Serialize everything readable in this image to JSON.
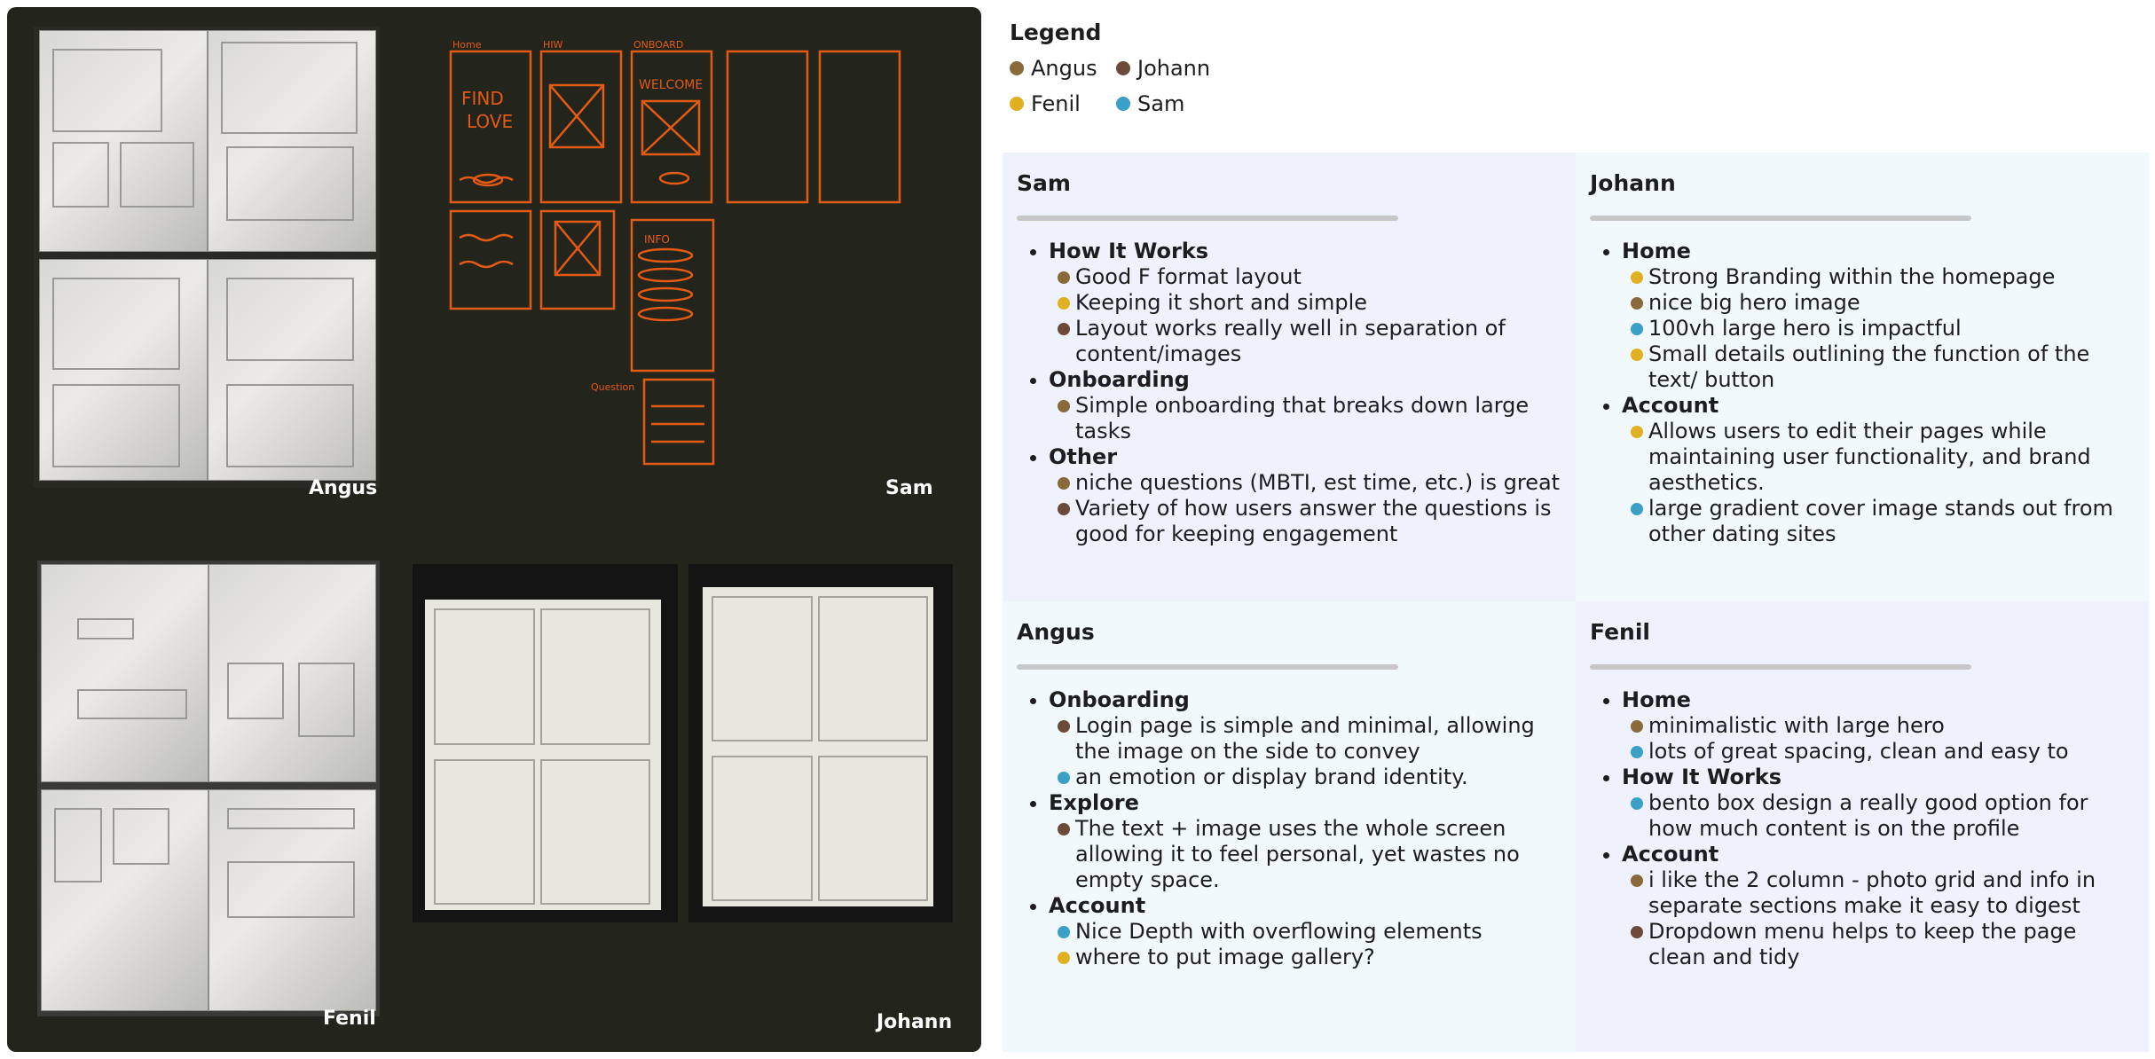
{
  "legend": {
    "title": "Legend",
    "people": [
      {
        "name": "Angus",
        "color": "#8a6a3b"
      },
      {
        "name": "Johann",
        "color": "#6b4a3a"
      },
      {
        "name": "Fenil",
        "color": "#e0b020"
      },
      {
        "name": "Sam",
        "color": "#3aa0c8"
      }
    ]
  },
  "photos": {
    "angus_caption": "Angus",
    "sam_caption": "Sam",
    "fenil_caption": "Fenil",
    "johann_caption": "Johann",
    "sam_sketch": {
      "color": "#e35a14",
      "labels": [
        "Home",
        "HIW",
        "ONBOARD",
        "FIND LOVE",
        "WELCOME",
        "INFO",
        "Question"
      ]
    }
  },
  "cards": [
    {
      "person": "Sam",
      "sections": [
        {
          "title": "How It Works",
          "items": [
            {
              "by": "Angus",
              "text": "Good F format layout"
            },
            {
              "by": "Fenil",
              "text": "Keeping it short and simple"
            },
            {
              "by": "Johann",
              "text": "Layout works really well in separation of content/images"
            }
          ]
        },
        {
          "title": "Onboarding",
          "items": [
            {
              "by": "Angus",
              "text": "Simple onboarding that breaks down large tasks"
            }
          ]
        },
        {
          "title": "Other",
          "items": [
            {
              "by": "Angus",
              "text": "niche questions (MBTI, est time, etc.) is great"
            },
            {
              "by": "Johann",
              "text": "Variety of how users answer the questions is good for keeping engagement"
            }
          ]
        }
      ]
    },
    {
      "person": "Johann",
      "sections": [
        {
          "title": "Home",
          "items": [
            {
              "by": "Fenil",
              "text": "Strong Branding within the homepage"
            },
            {
              "by": "Angus",
              "text": "nice big hero image"
            },
            {
              "by": "Sam",
              "text": "100vh large hero is impactful"
            },
            {
              "by": "Fenil",
              "text": "Small details outlining the function of the text/ button"
            }
          ]
        },
        {
          "title": "Account",
          "items": [
            {
              "by": "Fenil",
              "text": "Allows users to edit their pages while maintaining user functionality, and brand aesthetics."
            },
            {
              "by": "Sam",
              "text": "large gradient cover image stands out from other dating sites"
            }
          ]
        }
      ]
    },
    {
      "person": "Angus",
      "sections": [
        {
          "title": "Onboarding",
          "items": [
            {
              "by": "Johann",
              "text": "Login page is simple and minimal, allowing the image on the side to convey"
            },
            {
              "by": "Sam",
              "text": "an emotion or display brand identity."
            }
          ]
        },
        {
          "title": "Explore",
          "items": [
            {
              "by": "Johann",
              "text": "The text + image uses the whole screen allowing it to feel personal, yet wastes no empty space."
            }
          ]
        },
        {
          "title": "Account",
          "items": [
            {
              "by": "Sam",
              "text": "Nice Depth with overflowing elements"
            },
            {
              "by": "Fenil",
              "text": "where to put image gallery?"
            }
          ]
        }
      ]
    },
    {
      "person": "Fenil",
      "sections": [
        {
          "title": "Home",
          "items": [
            {
              "by": "Angus",
              "text": "minimalistic with large hero"
            },
            {
              "by": "Sam",
              "text": "lots of great spacing, clean and easy to"
            }
          ]
        },
        {
          "title": "How It Works",
          "items": [
            {
              "by": "Sam",
              "text": "bento box design a really good option for how much content is on the profile"
            }
          ]
        },
        {
          "title": "Account",
          "items": [
            {
              "by": "Angus",
              "text": "i like the 2 column - photo grid and info in separate sections make it easy to digest"
            },
            {
              "by": "Johann",
              "text": "Dropdown menu helps to keep the page clean and tidy"
            }
          ]
        }
      ]
    }
  ],
  "colors": {
    "panel_bg": "#23241c",
    "card_bg_a": "#eff2fd",
    "card_bg_b": "#f1f9fd"
  }
}
